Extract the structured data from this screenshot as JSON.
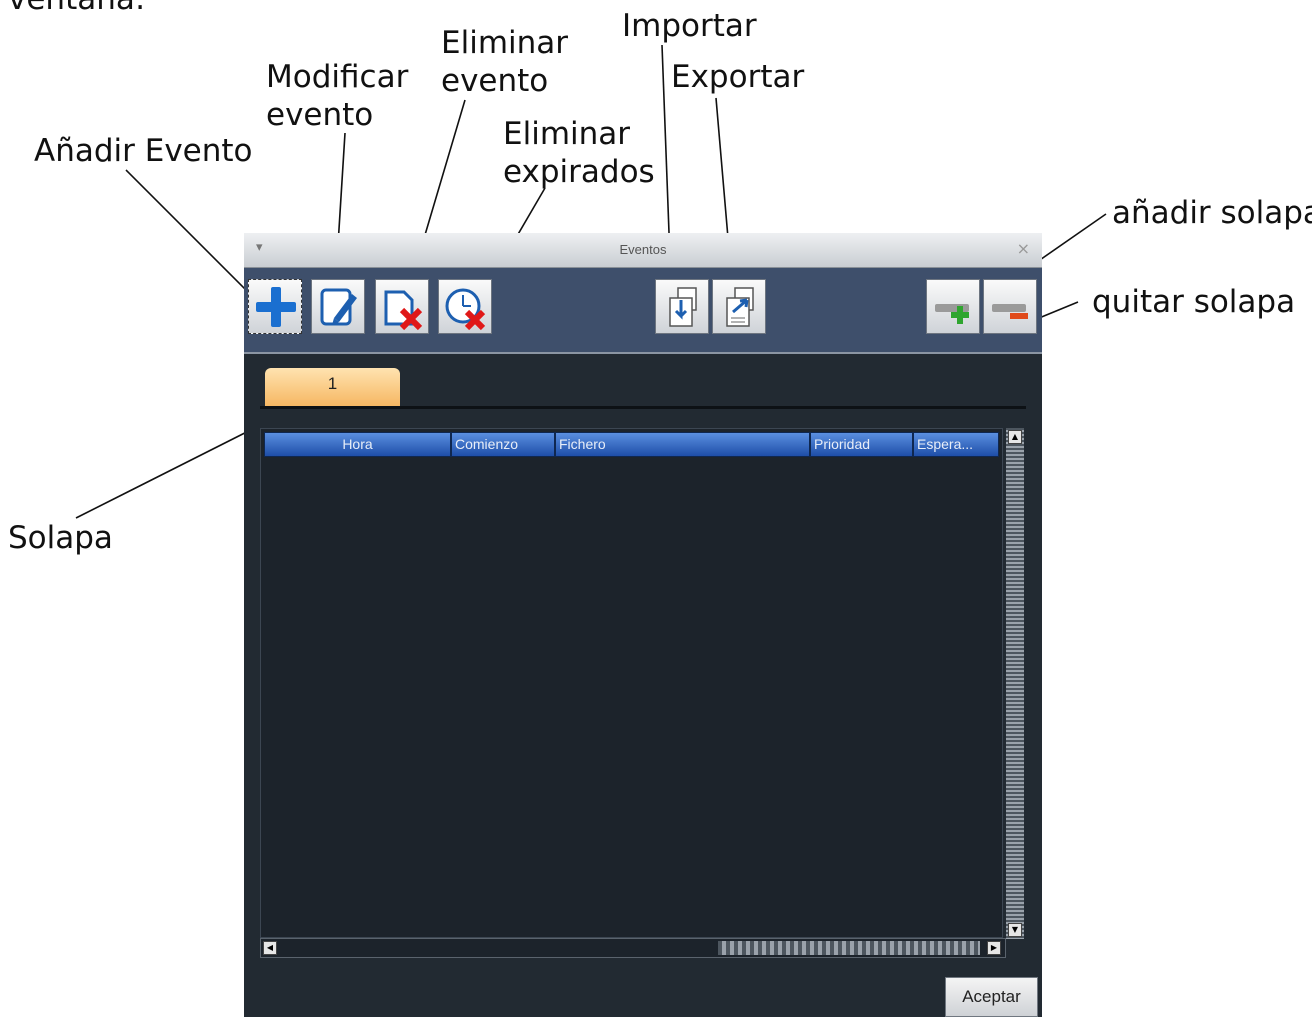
{
  "annotations": {
    "top_fragment": "ventana:",
    "add_event": "Añadir Evento",
    "modify_event": [
      "Modificar",
      "evento"
    ],
    "delete_event": [
      "Eliminar",
      "evento"
    ],
    "delete_expired": [
      "Eliminar",
      "expirados"
    ],
    "import": "Importar",
    "export": "Exportar",
    "add_tab": "añadir solapa",
    "remove_tab": "quitar solapa",
    "tab": "Solapa"
  },
  "window": {
    "title": "Eventos",
    "menu_glyph": "▾",
    "close_glyph": "×"
  },
  "toolbar": {
    "buttons": [
      {
        "name": "add-event-button",
        "icon": "plus-icon"
      },
      {
        "name": "modify-event-button",
        "icon": "edit-document-icon"
      },
      {
        "name": "delete-event-button",
        "icon": "delete-document-icon"
      },
      {
        "name": "delete-expired-button",
        "icon": "delete-clock-icon"
      },
      {
        "name": "import-button",
        "icon": "import-icon"
      },
      {
        "name": "export-button",
        "icon": "export-icon"
      },
      {
        "name": "add-tab-button",
        "icon": "add-tab-icon"
      },
      {
        "name": "remove-tab-button",
        "icon": "remove-tab-icon"
      }
    ]
  },
  "tabs": [
    {
      "label": "1",
      "active": true
    }
  ],
  "table": {
    "columns": [
      "Hora",
      "Comienzo",
      "Fichero",
      "Prioridad",
      "Espera..."
    ],
    "rows": []
  },
  "footer": {
    "accept_label": "Aceptar"
  },
  "colors": {
    "toolbar_bg": "#3e4f6b",
    "panel_bg": "#222a32",
    "tab_active": "#f6b763",
    "header_blue": "#2f62c0",
    "delete_red": "#e01818",
    "add_green": "#2fa52f"
  }
}
